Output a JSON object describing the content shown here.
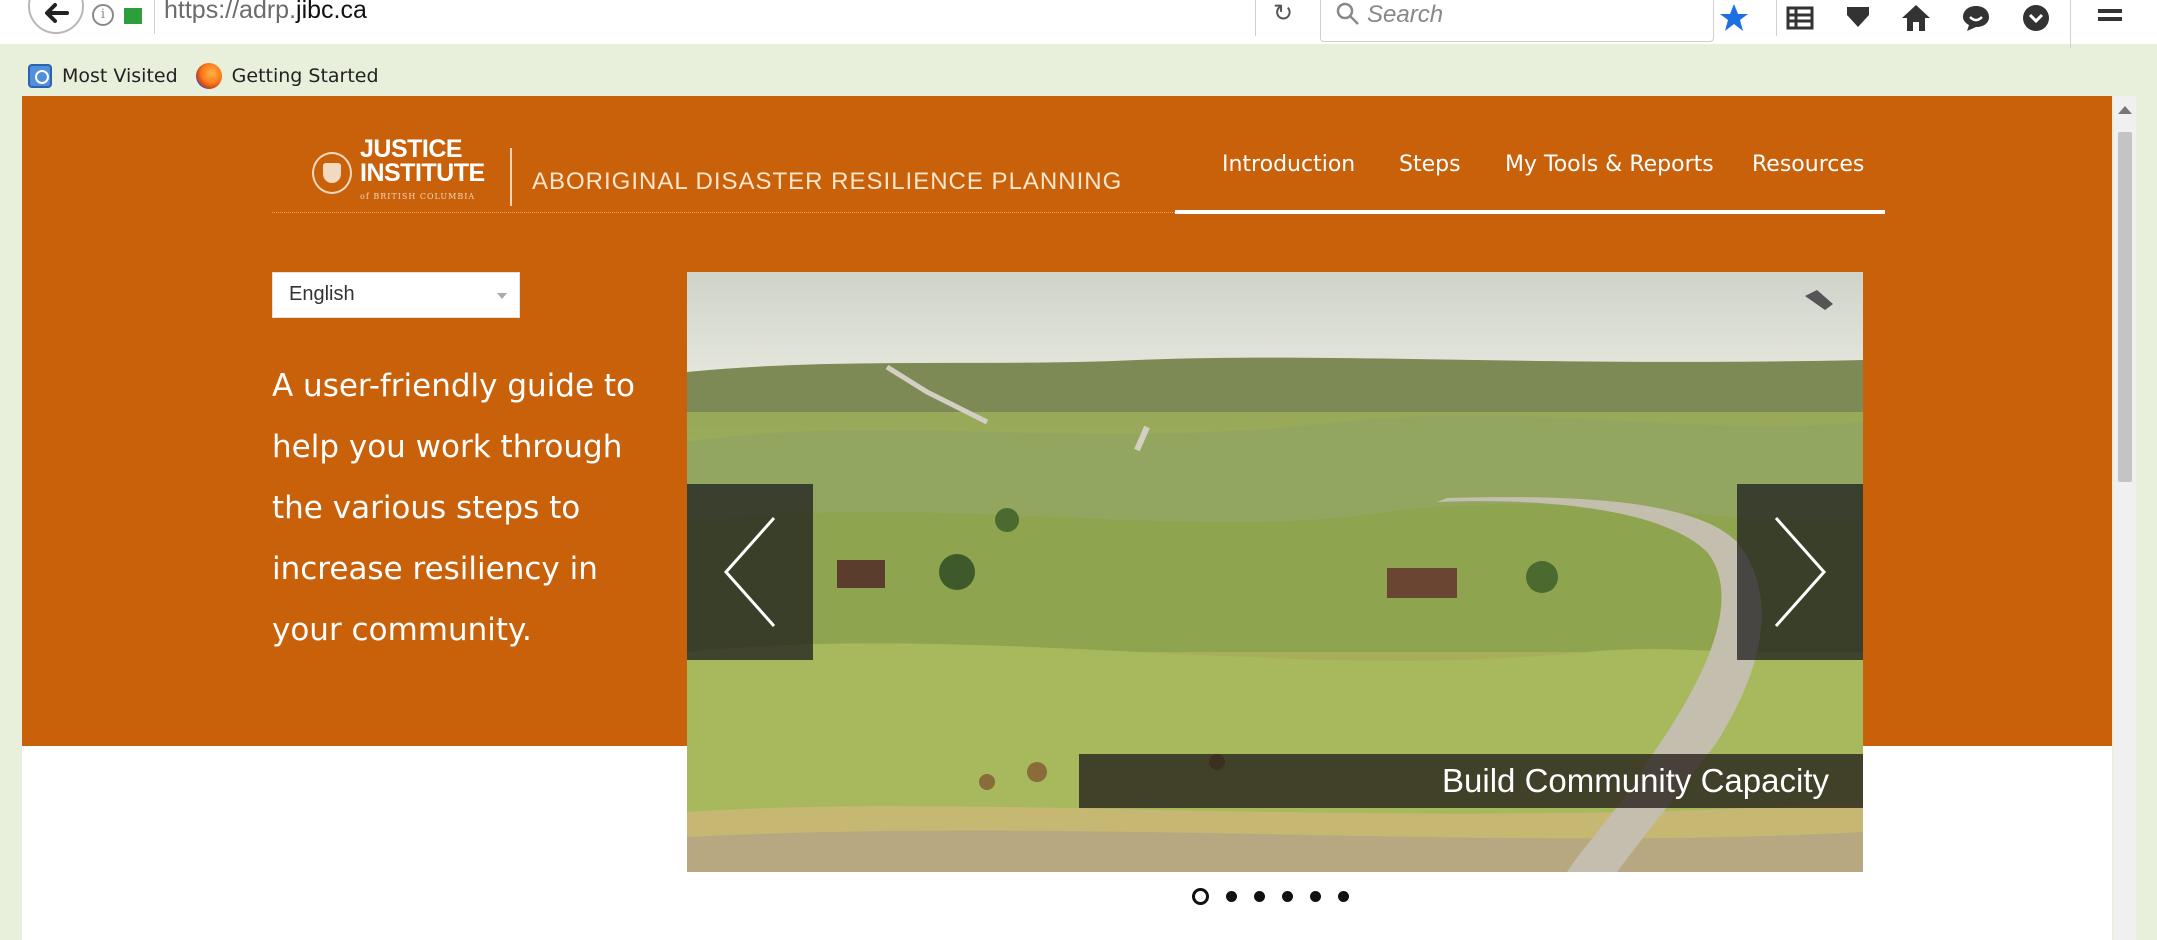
{
  "browser": {
    "url_prefix": "https://adrp.",
    "url_domain": "jibc.ca",
    "search_placeholder": "Search",
    "bookmarks": [
      {
        "label": "Most Visited"
      },
      {
        "label": "Getting Started"
      }
    ]
  },
  "site": {
    "logo_line1": "JUSTICE",
    "logo_line2": "INSTITUTE",
    "logo_line3": "of BRITISH COLUMBIA",
    "tagline": "ABORIGINAL DISASTER RESILIENCE PLANNING",
    "nav": [
      {
        "label": "Introduction"
      },
      {
        "label": "Steps"
      },
      {
        "label": "My Tools & Reports"
      },
      {
        "label": "Resources"
      }
    ],
    "language": "English",
    "intro": "A user-friendly guide to help you work through the various steps to increase resiliency in your community."
  },
  "slider": {
    "caption": "Build Community Capacity",
    "dots_count": 6,
    "active_dot": 1
  },
  "colors": {
    "brand_orange": "#c9600a",
    "page_bg": "#e8f0dc"
  }
}
